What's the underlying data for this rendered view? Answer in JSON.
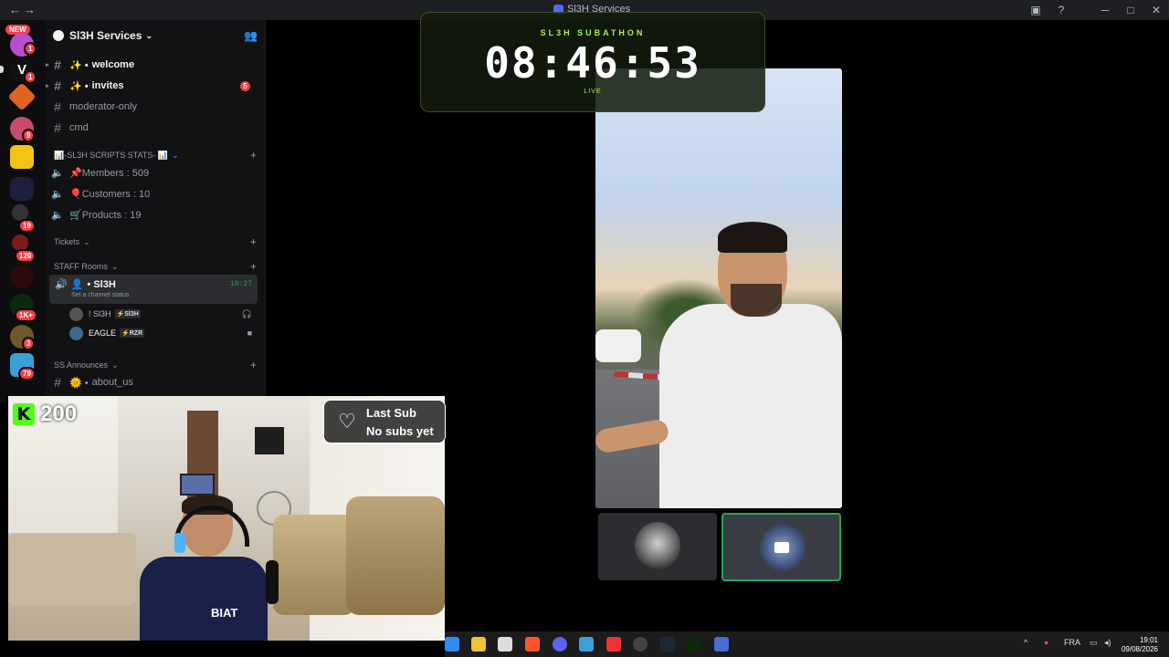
{
  "window": {
    "title": "Sl3H Services"
  },
  "rail": {
    "new_badge": "NEW",
    "badges": [
      "1",
      "1",
      "9",
      "19",
      "120",
      "1K+",
      "3",
      "79"
    ]
  },
  "server": {
    "name": "Sl3H Services"
  },
  "channels": [
    {
      "name": "welcome",
      "prefix": "✨ •"
    },
    {
      "name": "invites",
      "prefix": "✨ •",
      "unread": "5"
    },
    {
      "name": "moderator-only"
    },
    {
      "name": "cmd"
    }
  ],
  "stats_category": {
    "label": "📊-SL3H SCRIPTS STATS- 📊"
  },
  "stats_channels": [
    {
      "name": "📌Members : 509"
    },
    {
      "name": "🎈Customers : 10"
    },
    {
      "name": "🛒Products : 19"
    }
  ],
  "tickets_category": {
    "label": "Tickets"
  },
  "staff_category": {
    "label": "STAFF Rooms"
  },
  "voice_channel": {
    "name": "• Sl3H",
    "time": "10:27",
    "status": "Set a channel status"
  },
  "voice_users": [
    {
      "name": "! Sl3H",
      "tag": "⚡Sl3H"
    },
    {
      "name": "EAGLE",
      "tag": "⚡RZR"
    }
  ],
  "announce_category": {
    "label": "SS Announces"
  },
  "announce_channels": [
    {
      "name": "about_us",
      "prefix": "🌞 •"
    }
  ],
  "kick": {
    "logo": "K",
    "count": "200"
  },
  "last_sub": {
    "title": "Last Sub",
    "value": "No subs yet"
  },
  "webcam": {
    "shirt_text": "BIAT"
  },
  "timer": {
    "label": "SL3H SUBATHON",
    "value": "08:46:53",
    "status": "LIVE"
  },
  "taskbar": {
    "lang": "FRA",
    "time": "19:01",
    "date": "09/08/2026"
  },
  "colors": {
    "accent": "#5865f2",
    "green": "#23a55a",
    "timer_green": "#a9f04a",
    "kick_green": "#53fc18",
    "red": "#f23f43"
  }
}
